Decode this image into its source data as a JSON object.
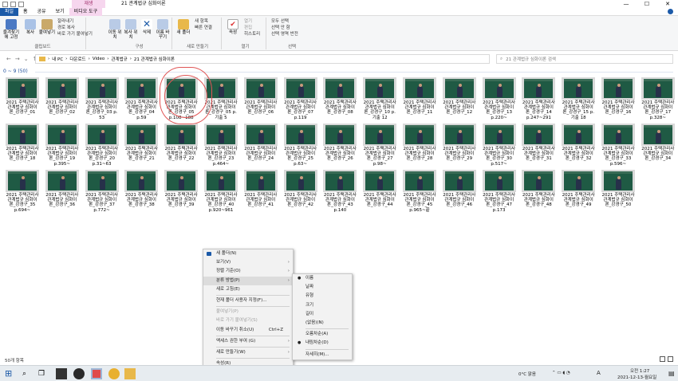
{
  "window": {
    "title": "21 관계법규 심화이론",
    "tools_tab_header": "재생"
  },
  "ribbon_tabs": [
    "파일",
    "홈",
    "공유",
    "보기",
    "비디오 도구"
  ],
  "ribbon": {
    "clipboard": {
      "label": "클립보드",
      "pin": "즐겨찾기에 고정",
      "copy": "복사",
      "paste": "붙여넣기",
      "cut": "잘라내기",
      "copy_path": "경로 복사",
      "paste_shortcut": "바로 가기 붙여넣기"
    },
    "organize": {
      "label": "구성",
      "move_to": "이동 위치",
      "copy_to": "복사 위치",
      "delete": "삭제",
      "rename": "이름 바꾸기"
    },
    "new": {
      "label": "새로 만들기",
      "new_folder": "새 폴더",
      "new_item": "새 항목",
      "easy_access": "빠른 연결"
    },
    "open": {
      "label": "열기",
      "properties": "속성",
      "open": "열기",
      "edit": "편집",
      "history": "히스토리"
    },
    "select": {
      "label": "선택",
      "select_all": "모두 선택",
      "select_none": "선택 안 함",
      "invert": "선택 영역 반전"
    }
  },
  "address": {
    "path": [
      "내 PC",
      "다운로드",
      "Video",
      "관계법규",
      "21 관계법규 심화이론"
    ]
  },
  "search": {
    "placeholder": "21 관계법규 심화이론 검색"
  },
  "group_header": "0 ~ 9 (50)",
  "files": [
    [
      "2021 주택관리사",
      "관계법규 심화이",
      "론_강경구_01"
    ],
    [
      "2021 주택관리사",
      "관계법규 심화이",
      "론_강경구_02"
    ],
    [
      "2021 주택관리사",
      "관계법규 심화이",
      "론_강경구_03 p.",
      "53"
    ],
    [
      "2021 주택관리사",
      "관계법규 심화이",
      "론_강경구_04",
      "p.59"
    ],
    [
      "2021 주택관리사",
      "관계법규 심화이",
      "론_강경구_05",
      "p.108~188"
    ],
    [
      "2021 주택관리사",
      "관계법규 심화이",
      "론_강경구_05 p.",
      "기출 5"
    ],
    [
      "2021 주택관리사",
      "관계법규 심화이",
      "론_강경구_06"
    ],
    [
      "2021 주택관리사",
      "관계법규 심화이",
      "론_강경구_07",
      "p.119"
    ],
    [
      "2021 주택관리사",
      "관계법규 심화이",
      "론_강경구_08"
    ],
    [
      "2021 주택관리사",
      "관계법규 심화이",
      "론_강경구_10 p.",
      "기출 12"
    ],
    [
      "2021 주택관리사",
      "관계법규 심화이",
      "론_강경구_11"
    ],
    [
      "2021 주택관리사",
      "관계법규 심화이",
      "론_강경구_12"
    ],
    [
      "2021 주택관리사",
      "관계법규 심화이",
      "론_강경구_13",
      "p.220~"
    ],
    [
      "2021 주택관리사",
      "관계법규 심화이",
      "론_강경구_14",
      "p.247~291"
    ],
    [
      "2021 주택관리사",
      "관계법규 심화이",
      "론_강경구_15 p.",
      "기출 18"
    ],
    [
      "2021 주택관리사",
      "관계법규 심화이",
      "론_강경구_16"
    ],
    [
      "2021 주택관리사",
      "관계법규 심화이",
      "론_강경구_17",
      "p.328~"
    ],
    [
      "2021 주택관리사",
      "관계법규 심화이",
      "론_강경구_18"
    ],
    [
      "2021 주택관리사",
      "관계법규 심화이",
      "론_강경구_19",
      "p.395~"
    ],
    [
      "2021 주택관리사",
      "관계법규 심화이",
      "론_강경구_20",
      "p.31~63"
    ],
    [
      "2021 주택관리사",
      "관계법규 심화이",
      "론_강경구_21"
    ],
    [
      "2021 주택관리사",
      "관계법규 심화이",
      "론_강경구_22"
    ],
    [
      "2021 주택관리사",
      "관계법규 심화이",
      "론_강경구_23",
      "p.464~"
    ],
    [
      "2021 주택관리사",
      "관계법규 심화이",
      "론_강경구_24"
    ],
    [
      "2021 주택관리사",
      "관계법규 심화이",
      "론_강경구_25",
      "p.63~"
    ],
    [
      "2021 주택관리사",
      "관계법규 심화이",
      "론_강경구_26"
    ],
    [
      "2021 주택관리사",
      "관계법규 심화이",
      "론_강경구_27",
      "p.98~"
    ],
    [
      "2021 주택관리사",
      "관계법규 심화이",
      "론_강경구_28"
    ],
    [
      "2021 주택관리사",
      "관계법규 심화이",
      "론_강경구_29"
    ],
    [
      "2021 주택관리사",
      "관계법규 심화이",
      "론_강경구_30",
      "p.517~"
    ],
    [
      "2021 주택관리사",
      "관계법규 심화이",
      "론_강경구_31"
    ],
    [
      "2021 주택관리사",
      "관계법규 심화이",
      "론_강경구_32"
    ],
    [
      "2021 주택관리사",
      "관계법규 심화이",
      "론_강경구_33",
      "p.596~"
    ],
    [
      "2021 주택관리사",
      "관계법규 심화이",
      "론_강경구_34"
    ],
    [
      "2021 주택관리사",
      "관계법규 심화이",
      "론_강경구_35",
      "p.694~"
    ],
    [
      "2021 주택관리사",
      "관계법규 심화이",
      "론_강경구_36"
    ],
    [
      "2021 주택관리사",
      "관계법규 심화이",
      "론_강경구_37",
      "p.772~"
    ],
    [
      "2021 주택관리사",
      "관계법규 심화이",
      "론_강경구_38"
    ],
    [
      "2021 주택관리사",
      "관계법규 심화이",
      "론_강경구_39"
    ],
    [
      "2021 주택관리사",
      "관계법규 심화이",
      "론_강경구_40",
      "p.920~961"
    ],
    [
      "2021 주택관리사",
      "관계법규 심화이",
      "론_강경구_41"
    ],
    [
      "2021 주택관리사",
      "관계법규 심화이",
      "론_강경구_42"
    ],
    [
      "2021 주택관리사",
      "관계법규 심화이",
      "론_강경구_43",
      "p.140"
    ],
    [
      "2021 주택관리사",
      "관계법규 심화이",
      "론_강경구_44"
    ],
    [
      "2021 주택관리사",
      "관계법규 심화이",
      "론_강경구_45",
      "p.965~끝"
    ],
    [
      "2021 주택관리사",
      "관계법규 심화이",
      "론_강경구_46"
    ],
    [
      "2021 주택관리사",
      "관계법규 심화이",
      "론_강경구_47",
      "p.173"
    ],
    [
      "2021 주택관리사",
      "관계법규 심화이",
      "론_강경구_48"
    ],
    [
      "2021 주택관리사",
      "관계법규 심화이",
      "론_강경구_49"
    ],
    [
      "2021 주택관리사",
      "관계법규 심화이",
      "론_강경구_50"
    ]
  ],
  "context_menu": [
    {
      "label": "새 폴더(N)",
      "icon": true
    },
    {
      "label": "보기(V)",
      "sub": true
    },
    {
      "label": "정렬 기준(O)",
      "sub": true
    },
    {
      "label": "분류 방법(P)",
      "sub": true
    },
    {
      "label": "새로 고침(E)"
    },
    {
      "sep": true
    },
    {
      "label": "현재 폴더 사용자 지정(F)..."
    },
    {
      "sep": true
    },
    {
      "label": "붙여넣기(P)",
      "disabled": true
    },
    {
      "label": "바로 가기 붙여넣기(S)",
      "disabled": true
    },
    {
      "label": "이동 바꾸기 취소(U)",
      "shortcut": "Ctrl+Z"
    },
    {
      "sep": true
    },
    {
      "label": "액세스 권한 부여 (G)",
      "sub": true
    },
    {
      "sep": true
    },
    {
      "label": "새로 만들기(W)",
      "sub": true
    },
    {
      "sep": true
    },
    {
      "label": "속성(R)"
    }
  ],
  "submenu": [
    {
      "label": "이름",
      "mark": "●"
    },
    {
      "label": "날짜"
    },
    {
      "label": "유형"
    },
    {
      "label": "크기"
    },
    {
      "label": "길이"
    },
    {
      "label": "(없음)(N)"
    },
    {
      "sep": true
    },
    {
      "label": "오름차순(A)"
    },
    {
      "label": "내림차순(D)",
      "mark": "●"
    },
    {
      "sep": true
    },
    {
      "label": "자세히(M)..."
    }
  ],
  "status": {
    "count": "50개 항목"
  },
  "taskbar": {
    "weather": "0°C 맑음",
    "lang": "A",
    "time": "오전 1:27",
    "date": "2021-12-13-월요일"
  }
}
